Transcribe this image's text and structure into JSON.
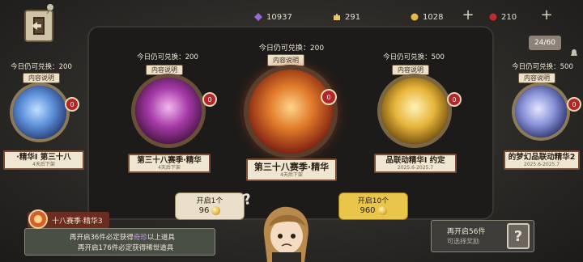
{
  "resources": [
    {
      "icon": "purple-gem-icon",
      "value": "10937",
      "color": "#9a6ad8"
    },
    {
      "icon": "puzzle-piece-icon",
      "value": "291",
      "color": "#e8c568"
    },
    {
      "icon": "gold-coin-icon",
      "value": "1028",
      "color": "#e8b844"
    },
    {
      "icon": "red-gem-icon",
      "value": "210",
      "color": "#c02a2e"
    }
  ],
  "plus_label": "+",
  "counter": "24/60",
  "info_label": "内容说明",
  "cards": [
    {
      "quota": "今日仍可兑换：200",
      "title": "·精华I   第三十八",
      "subtitle": "4天后下架",
      "badge": "0",
      "color": "#6fa6e8"
    },
    {
      "quota": "今日仍可兑换：200",
      "title": "第三十八赛季·精华",
      "subtitle": "4天后下架",
      "badge": "0",
      "color": "#b04bb6"
    },
    {
      "quota": "今日仍可兑换：200",
      "title": "第三十八赛季·精华",
      "subtitle": "4天后下架",
      "badge": "0",
      "color": "#d2622a"
    },
    {
      "quota": "今日仍可兑换：500",
      "title": "品联动精华I   约定",
      "subtitle": "2025.6-2025.7",
      "badge": "0",
      "color": "#d8b23a"
    },
    {
      "quota": "今日仍可兑换：500",
      "title": "的梦幻品联动精华2",
      "subtitle": "2025.6-2025.7",
      "badge": "0",
      "color": "#7d86d0"
    }
  ],
  "open1": {
    "label": "开启1个",
    "cost": "96"
  },
  "open10": {
    "label": "开启10个",
    "cost": "960"
  },
  "bottom_left": {
    "tag": "十八赛季·精华3",
    "line1_prefix": "再开启36件必定获得",
    "line1_highlight": "奇珍",
    "line1_suffix": "以上道具",
    "line2": "再开启176件必定获得稀世道具"
  },
  "bottom_right": {
    "line1": "再开启56件",
    "line2": "可选择奖励",
    "icon_text": "?"
  },
  "question_mark": "?"
}
